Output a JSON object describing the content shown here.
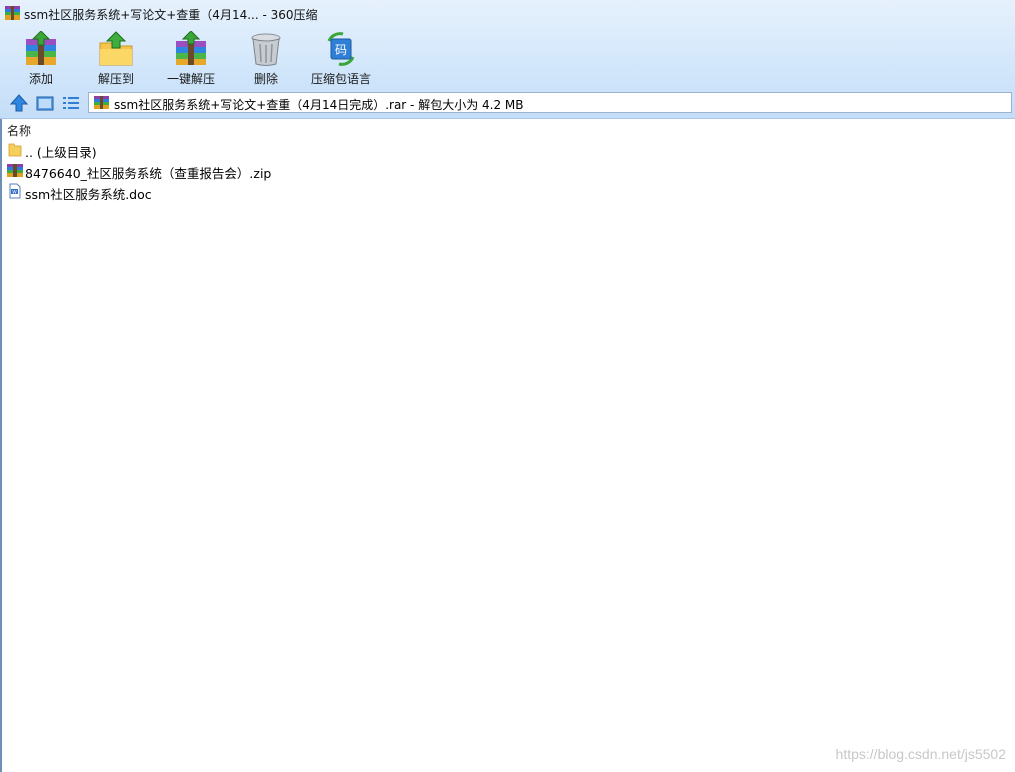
{
  "window": {
    "title": "ssm社区服务系统+写论文+查重（4月14... - 360压缩"
  },
  "toolbar": {
    "items": [
      {
        "label": "添加",
        "icon": "add-archive-icon"
      },
      {
        "label": "解压到",
        "icon": "extract-to-icon"
      },
      {
        "label": "一键解压",
        "icon": "one-click-extract-icon"
      },
      {
        "label": "删除",
        "icon": "trash-bin-icon"
      },
      {
        "label": "压缩包语言",
        "icon": "archive-language-icon"
      }
    ]
  },
  "nav": {
    "address": "ssm社区服务系统+写论文+查重（4月14日完成）.rar - 解包大小为 4.2 MB"
  },
  "list": {
    "column_name": "名称",
    "files": [
      {
        "name": ".. (上级目录)",
        "type": "folder-up"
      },
      {
        "name": "8476640_社区服务系统（查重报告会）.zip",
        "type": "zip"
      },
      {
        "name": "ssm社区服务系统.doc",
        "type": "doc"
      }
    ]
  },
  "watermark": "https://blog.csdn.net/js5502",
  "colors": {
    "toolbar_gradient_top": "#e6f1fc",
    "toolbar_gradient_bottom": "#c4ddf8",
    "nav_accent": "#2f7fd6"
  }
}
